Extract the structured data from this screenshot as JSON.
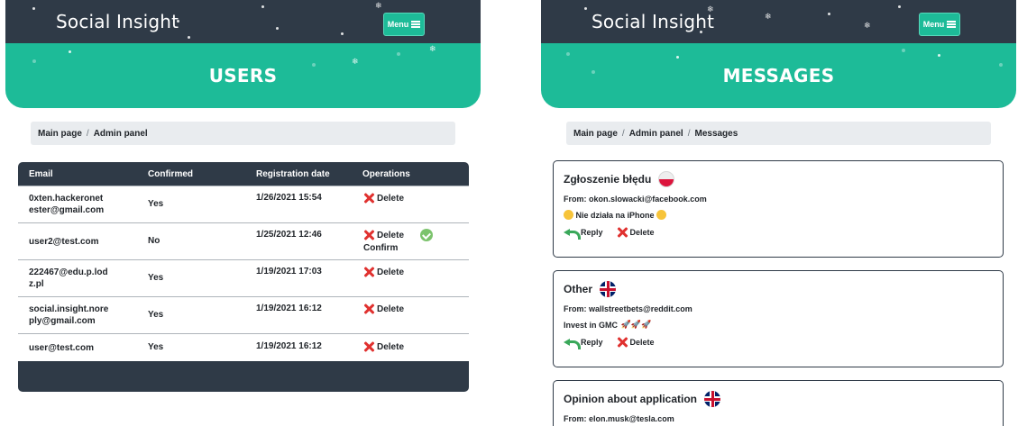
{
  "brand": "Social Insight",
  "menu_label": "Menu",
  "users_page": {
    "title": "USERS",
    "breadcrumb": [
      "Main page",
      "Admin panel"
    ],
    "columns": [
      "Email",
      "Confirmed",
      "Registration date",
      "Operations"
    ],
    "rows": [
      {
        "email_lines": [
          "0xten.hackeronet",
          "ester@gmail.com"
        ],
        "confirmed": "Yes",
        "registered": "1/26/2021 15:54",
        "delete_label": "Delete",
        "confirm_label": ""
      },
      {
        "email_lines": [
          "user2@test.com",
          ""
        ],
        "confirmed": "No",
        "registered": "1/25/2021 12:46",
        "delete_label": "Delete",
        "confirm_label": "Confirm"
      },
      {
        "email_lines": [
          "222467@edu.p.lod",
          "z.pl"
        ],
        "confirmed": "Yes",
        "registered": "1/19/2021 17:03",
        "delete_label": "Delete",
        "confirm_label": ""
      },
      {
        "email_lines": [
          "social.insight.nore",
          "ply@gmail.com"
        ],
        "confirmed": "Yes",
        "registered": "1/19/2021 16:12",
        "delete_label": "Delete",
        "confirm_label": ""
      },
      {
        "email_lines": [
          "user@test.com",
          ""
        ],
        "confirmed": "Yes",
        "registered": "1/19/2021 16:12",
        "delete_label": "Delete",
        "confirm_label": ""
      }
    ]
  },
  "messages_page": {
    "title": "MESSAGES",
    "breadcrumb": [
      "Main page",
      "Admin panel",
      "Messages"
    ],
    "reply_label": "Reply",
    "delete_label": "Delete",
    "messages": [
      {
        "subject": "Zgłoszenie błędu",
        "flag": "flag-pl-icon",
        "from": "From: okon.slowacki@facebook.com",
        "body": "Nie działa na iPhone"
      },
      {
        "subject": "Other",
        "flag": "flag-uk-icon",
        "from": "From: wallstreetbets@reddit.com",
        "body": "Invest in GMC"
      },
      {
        "subject": "Opinion about application",
        "flag": "flag-uk-icon",
        "from": "From: elon.musk@tesla.com",
        "body": ""
      }
    ]
  },
  "colors": {
    "navbar": "#2f3a47",
    "accent": "#1dbb98",
    "delete": "#e0312f",
    "reply": "#3aa85a"
  }
}
